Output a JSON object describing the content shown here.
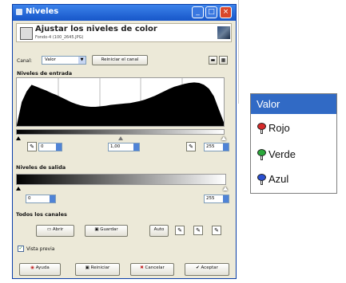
{
  "dialog": {
    "window_title": "Niveles",
    "header_title": "Ajustar los niveles de color",
    "header_subtitle": "Fondo-4 (100_2645.JPG)",
    "window_buttons": {
      "minimize": "_",
      "maximize": "□",
      "close": "×"
    }
  },
  "channel": {
    "label": "Canal:",
    "value": "Valor",
    "reset_button": "Reiniciar el canal",
    "linear_icon": "linear-histogram-icon",
    "log_icon": "log-histogram-icon"
  },
  "input_levels": {
    "heading": "Niveles de entrada",
    "black_value": "0",
    "gamma_value": "1,00",
    "white_value": "255"
  },
  "output_levels": {
    "heading": "Niveles de salida",
    "black_value": "0",
    "white_value": "255"
  },
  "all_channels": {
    "heading": "Todos los canales",
    "open_button": "Abrir",
    "save_button": "Guardar",
    "auto_button": "Auto"
  },
  "preview": {
    "label": "Vista previa",
    "checked": true
  },
  "footer": {
    "help_button": "Ayuda",
    "reset_button": "Reiniciar",
    "cancel_button": "Cancelar",
    "accept_button": "Aceptar"
  },
  "channel_menu": {
    "selected": "Valor",
    "options": [
      {
        "label": "Rojo",
        "color": "#d62a2a"
      },
      {
        "label": "Verde",
        "color": "#2aa83a"
      },
      {
        "label": "Azul",
        "color": "#2a4fd0"
      }
    ]
  },
  "histogram_levels": [
    0.02,
    0.5,
    0.72,
    0.86,
    0.82,
    0.78,
    0.74,
    0.69,
    0.65,
    0.6,
    0.55,
    0.5,
    0.46,
    0.43,
    0.41,
    0.4,
    0.4,
    0.41,
    0.42,
    0.44,
    0.45,
    0.46,
    0.47,
    0.48,
    0.5,
    0.52,
    0.55,
    0.59,
    0.63,
    0.68,
    0.73,
    0.78,
    0.82,
    0.85,
    0.88,
    0.9,
    0.91,
    0.9,
    0.86,
    0.78,
    0.62,
    0.35,
    0.08
  ]
}
